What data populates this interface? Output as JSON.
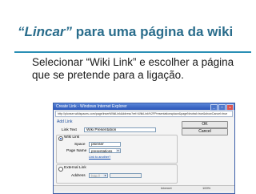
{
  "slide": {
    "title_quoted": "“Lincar”",
    "title_rest": "para uma página da wiki",
    "bullet_symbol": "",
    "bullet_text": "Selecionar “Wiki Link” e escolher a página que se pretende para a ligação.",
    "accent_color": "#2a6d8c"
  },
  "window": {
    "title": "Create Link - Windows Internet Explorer",
    "address": "http://plonser.wikispaces.com/page/insertWikiLinkAddress?ref=WikiLink%2FPresentationsplace&pageNeutral=true&showCancel=true",
    "controls": [
      "_",
      "□",
      "x"
    ]
  },
  "dialog": {
    "heading": "Add Link",
    "ok_label": "OK",
    "cancel_label": "Cancel",
    "link_text_label": "Link Text",
    "link_text_value": "Wiki Presentation",
    "wiki_link_label": "Wiki Link",
    "space_label": "Space",
    "space_value": "plonser",
    "page_name_label": "Page Name",
    "page_name_value": "presentations",
    "page_link_hint": "Link to another?",
    "external_link_label": "External Link",
    "address_label": "Address",
    "address_value": "http://"
  },
  "statusbar": {
    "zone": "Internet",
    "zoom": "100%"
  }
}
